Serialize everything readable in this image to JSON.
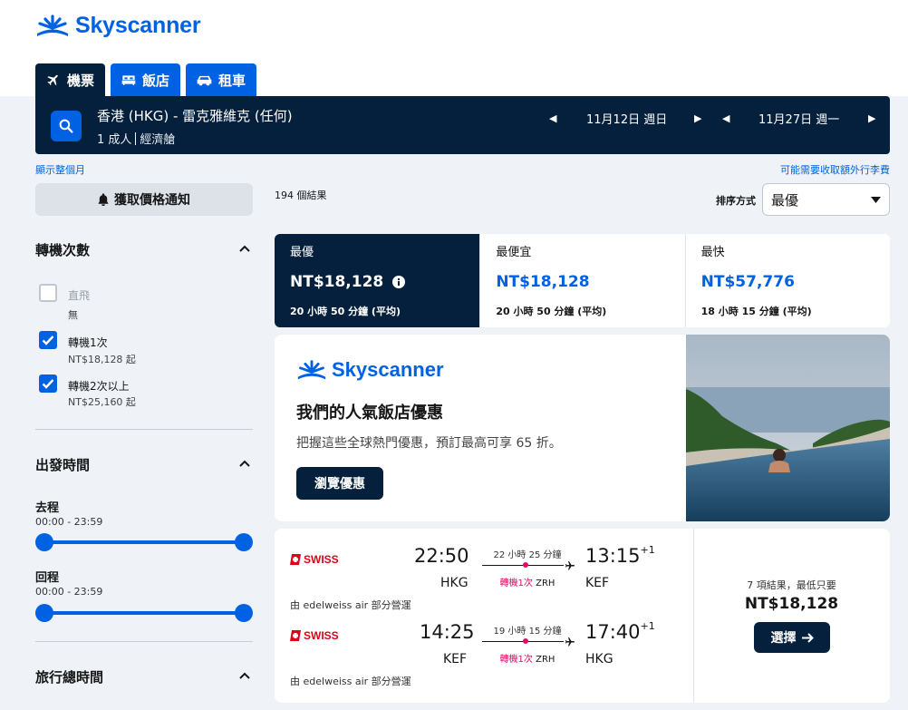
{
  "brand": {
    "name": "Skyscanner",
    "color": "#0062e3",
    "dark": "#05203c"
  },
  "tabs": [
    {
      "label": "機票",
      "icon": "plane-icon",
      "active": true
    },
    {
      "label": "飯店",
      "icon": "bed-icon",
      "active": false
    },
    {
      "label": "租車",
      "icon": "car-icon",
      "active": false
    }
  ],
  "search": {
    "route": "香港 (HKG) - 雷克雅維克 (任何)",
    "passengers": "1 成人",
    "cabin": "經濟艙",
    "depart_date": "11月12日 週日",
    "return_date": "11月27日 週一"
  },
  "links": {
    "whole_month": "顯示整個月",
    "baggage_fee": "可能需要收取額外行李費"
  },
  "sidebar": {
    "price_alert": "獲取價格通知",
    "stops": {
      "title": "轉機次數",
      "options": [
        {
          "label": "直飛",
          "sub": "無",
          "checked": false
        },
        {
          "label": "轉機1次",
          "sub": "NT$18,128 起",
          "checked": true
        },
        {
          "label": "轉機2次以上",
          "sub": "NT$25,160 起",
          "checked": true
        }
      ]
    },
    "depart_times": {
      "title": "出發時間",
      "outbound_label": "去程",
      "outbound_range": "00:00 - 23:59",
      "return_label": "回程",
      "return_range": "00:00 - 23:59"
    },
    "journey_duration": {
      "title": "旅行總時間"
    }
  },
  "results": {
    "count": "194 個結果",
    "sort_label": "排序方式",
    "sort_value": "最優",
    "sort_tabs": [
      {
        "name": "最優",
        "price": "NT$18,128",
        "duration": "20 小時 50 分鐘 (平均)",
        "active": true
      },
      {
        "name": "最便宜",
        "price": "NT$18,128",
        "duration": "20 小時 50 分鐘 (平均)",
        "active": false
      },
      {
        "name": "最快",
        "price": "NT$57,776",
        "duration": "18 小時 15 分鐘 (平均)",
        "active": false
      }
    ]
  },
  "ad": {
    "logo": "Skyscanner",
    "title": "我們的人氣飯店優惠",
    "subtitle": "把握這些全球熱門優惠，預訂最高可享 65 折。",
    "button": "瀏覽優惠"
  },
  "flight": {
    "outbound": {
      "airline": "SWISS",
      "depart_time": "22:50",
      "depart_code": "HKG",
      "arrive_time": "13:15",
      "arrive_offset": "+1",
      "arrive_code": "KEF",
      "duration": "22 小時 25 分鐘",
      "stops": "轉機1次",
      "via": "ZRH",
      "operated": "由 edelweiss air 部分營運"
    },
    "return": {
      "airline": "SWISS",
      "depart_time": "14:25",
      "depart_code": "KEF",
      "arrive_time": "17:40",
      "arrive_offset": "+1",
      "arrive_code": "HKG",
      "duration": "19 小時 15 分鐘",
      "stops": "轉機1次",
      "via": "ZRH",
      "operated": "由 edelweiss air 部分營運"
    },
    "deal_text": "7 項結果，最低只要",
    "deal_price": "NT$18,128",
    "select_label": "選擇"
  }
}
